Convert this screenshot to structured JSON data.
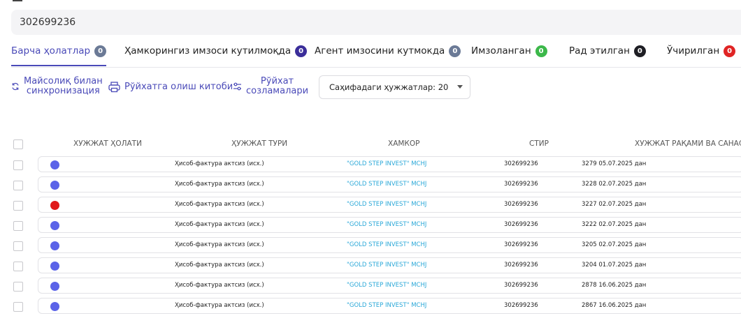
{
  "search": {
    "value": "302699236"
  },
  "tabs": [
    {
      "label": "Барча ҳолатлар",
      "count": "0",
      "color": "#6b7a96",
      "active": true
    },
    {
      "label": "Ҳамкорингиз имзоси кутилмоқда",
      "count": "0",
      "color": "#3b2e9a",
      "active": false
    },
    {
      "label": "Агент имзосини кутмокда",
      "count": "0",
      "color": "#6b7a96",
      "active": false
    },
    {
      "label": "Имзоланган",
      "count": "0",
      "color": "#3cb84a",
      "active": false
    },
    {
      "label": "Рад этилган",
      "count": "0",
      "color": "#1e1e24",
      "active": false
    },
    {
      "label": "Ўчирилган",
      "count": "0",
      "color": "#e02424",
      "active": false
    }
  ],
  "toolbar": {
    "sync_line1": "Майсолиқ билан",
    "sync_line2": "синхронизация",
    "book_label": "Рўйхатга олиш китоби",
    "settings_line1": "Рўйхат",
    "settings_line2": "созламалари",
    "per_page_label": "Саҳифадаги ҳужжатлар: 20"
  },
  "table": {
    "headers": {
      "status": "ХУЖЖАТ ҲОЛАТИ",
      "type": "ҲУЖЖАТ ТУРИ",
      "partner": "ХАМКОР",
      "stir": "СТИР",
      "number_date": "ХУЖЖАТ РАҚАМИ ВА САНАСИ"
    },
    "rows": [
      {
        "status_color": "#5b63e8",
        "type": "Ҳисоб-фактура актсиз (исх.)",
        "partner": "\"GOLD STEP INVEST\" MCHJ",
        "stir": "302699236",
        "number_date": "3279 05.07.2025 дан"
      },
      {
        "status_color": "#5b63e8",
        "type": "Ҳисоб-фактура актсиз (исх.)",
        "partner": "\"GOLD STEP INVEST\" MCHJ",
        "stir": "302699236",
        "number_date": "3228 02.07.2025 дан"
      },
      {
        "status_color": "#e01919",
        "type": "Ҳисоб-фактура актсиз (исх.)",
        "partner": "\"GOLD STEP INVEST\" MCHJ",
        "stir": "302699236",
        "number_date": "3227 02.07.2025 дан"
      },
      {
        "status_color": "#5b63e8",
        "type": "Ҳисоб-фактура актсиз (исх.)",
        "partner": "\"GOLD STEP INVEST\" MCHJ",
        "stir": "302699236",
        "number_date": "3222 02.07.2025 дан"
      },
      {
        "status_color": "#5b63e8",
        "type": "Ҳисоб-фактура актсиз (исх.)",
        "partner": "\"GOLD STEP INVEST\" MCHJ",
        "stir": "302699236",
        "number_date": "3205 02.07.2025 дан"
      },
      {
        "status_color": "#5b63e8",
        "type": "Ҳисоб-фактура актсиз (исх.)",
        "partner": "\"GOLD STEP INVEST\" MCHJ",
        "stir": "302699236",
        "number_date": "3204 01.07.2025 дан"
      },
      {
        "status_color": "#5b63e8",
        "type": "Ҳисоб-фактура актсиз (исх.)",
        "partner": "\"GOLD STEP INVEST\" MCHJ",
        "stir": "302699236",
        "number_date": "2878 16.06.2025 дан"
      },
      {
        "status_color": "#5b63e8",
        "type": "Ҳисоб-фактура актсиз (исх.)",
        "partner": "\"GOLD STEP INVEST\" MCHJ",
        "stir": "302699236",
        "number_date": "2867 16.06.2025 дан"
      }
    ]
  },
  "icons": {
    "sync": "sync-icon",
    "book": "printer-icon",
    "settings": "sliders-icon",
    "dropdown": "chevron-down-icon"
  }
}
